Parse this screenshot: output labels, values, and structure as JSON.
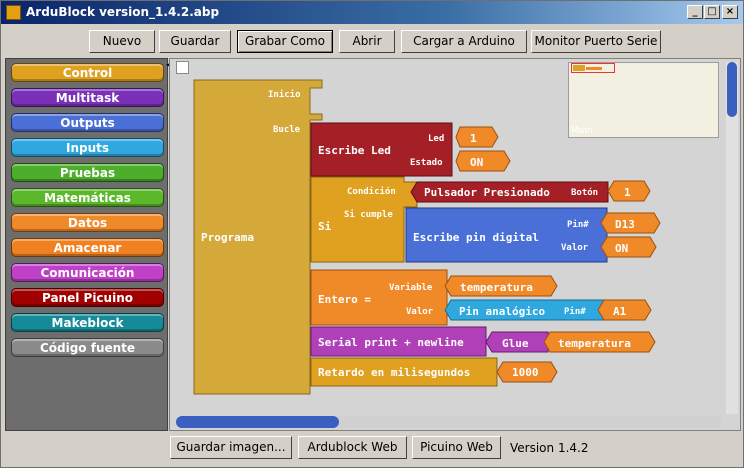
{
  "window": {
    "title": "ArduBlock version_1.4.2.abp"
  },
  "toolbar": {
    "buttons": [
      "Nuevo",
      "Guardar",
      "Grabar Como",
      "Abrir",
      "Cargar a Arduino",
      "Monitor Puerto Serie"
    ]
  },
  "sidebar": {
    "categories": [
      {
        "label": "Control",
        "color": "#e0a020"
      },
      {
        "label": "Multitask",
        "color": "#7a30b8"
      },
      {
        "label": "Outputs",
        "color": "#4a70d8"
      },
      {
        "label": "Inputs",
        "color": "#2fa8e0"
      },
      {
        "label": "Pruebas",
        "color": "#4cae2a"
      },
      {
        "label": "Matemáticas",
        "color": "#5cb82a"
      },
      {
        "label": "Datos",
        "color": "#f08a28"
      },
      {
        "label": "Amacenar",
        "color": "#f08020"
      },
      {
        "label": "Comunicación",
        "color": "#c040c8"
      },
      {
        "label": "Panel Picuino",
        "color": "#a00000"
      },
      {
        "label": "Makeblock",
        "color": "#158a98"
      },
      {
        "label": "Código fuente",
        "color": "#8a8a8a"
      }
    ]
  },
  "workspace": {
    "minimap_label": "Main",
    "program": {
      "label": "Programa",
      "setup_label": "Inicio",
      "loop_label": "Bucle"
    },
    "blocks": {
      "led": {
        "label": "Escribe Led",
        "param1": "Led",
        "param2": "Estado",
        "value1": "1",
        "value2": "ON"
      },
      "if": {
        "label": "Si",
        "cond_label": "Condición",
        "then_label": "Si cumple"
      },
      "button": {
        "label": "Pulsador Presionado",
        "param": "Botón",
        "value": "1"
      },
      "digital": {
        "label": "Escribe pin digital",
        "param1": "Pin#",
        "param2": "Valor",
        "value1": "D13",
        "value2": "ON"
      },
      "integer": {
        "label": "Entero =",
        "param1": "Variable",
        "param2": "Valor",
        "var_name": "temperatura"
      },
      "analog": {
        "label": "Pin analógico",
        "param": "Pin#",
        "value": "A1"
      },
      "serial": {
        "label": "Serial print + newline",
        "glue": "Glue",
        "value": "temperatura"
      },
      "delay": {
        "label": "Retardo en milisegundos",
        "value": "1000"
      }
    }
  },
  "footer": {
    "buttons": [
      "Guardar imagen...",
      "Ardublock Web",
      "Picuino Web"
    ],
    "version": "Version 1.4.2"
  },
  "colors": {
    "program": "#d4a93a",
    "led": "#a52026",
    "if": "#e0a020",
    "digital": "#4a70d8",
    "number": "#f08a28",
    "analog": "#2fa8e0",
    "serial": "#b040b8"
  }
}
